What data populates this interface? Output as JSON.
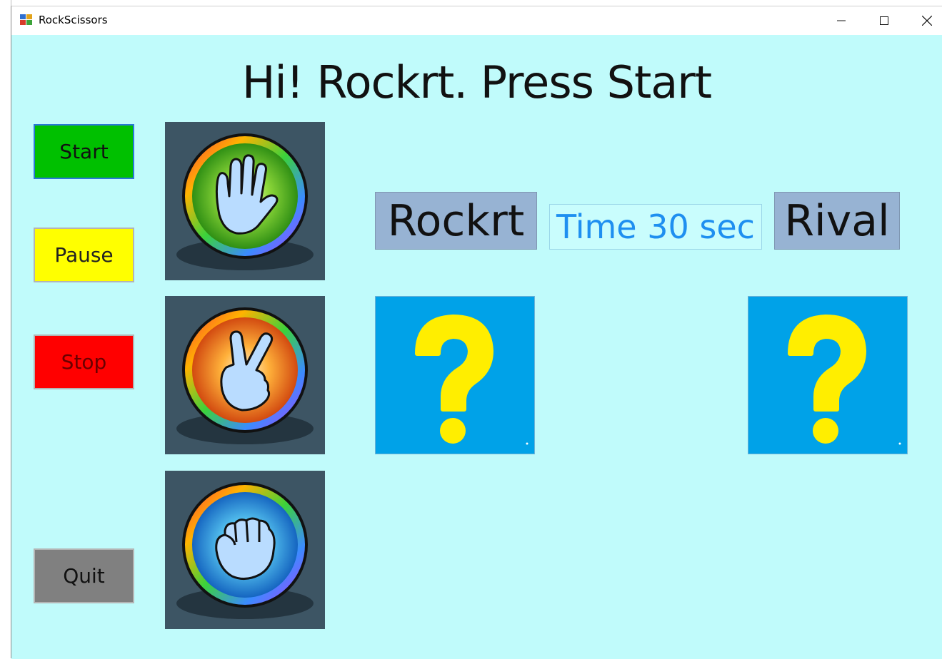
{
  "window": {
    "title": "RockScissors"
  },
  "heading": "Hi! Rockrt. Press Start",
  "controls": {
    "start_label": "Start",
    "pause_label": "Pause",
    "stop_label": "Stop",
    "quit_label": "Quit"
  },
  "hands": {
    "paper": "paper-hand-icon",
    "scissors": "scissors-hand-icon",
    "rock": "rock-hand-icon"
  },
  "scoreboard": {
    "player_name": "Rockrt",
    "timer_text": "Time 30 sec",
    "rival_name": "Rival"
  },
  "colors": {
    "background": "#c0fbfb",
    "start": "#00c000",
    "pause": "#ffff00",
    "stop": "#ff0000",
    "quit": "#808080",
    "name_label": "#97b3d3",
    "timer_text": "#1e8ff0",
    "choice_tile": "#00a2e8",
    "question_mark": "#ffee00"
  }
}
